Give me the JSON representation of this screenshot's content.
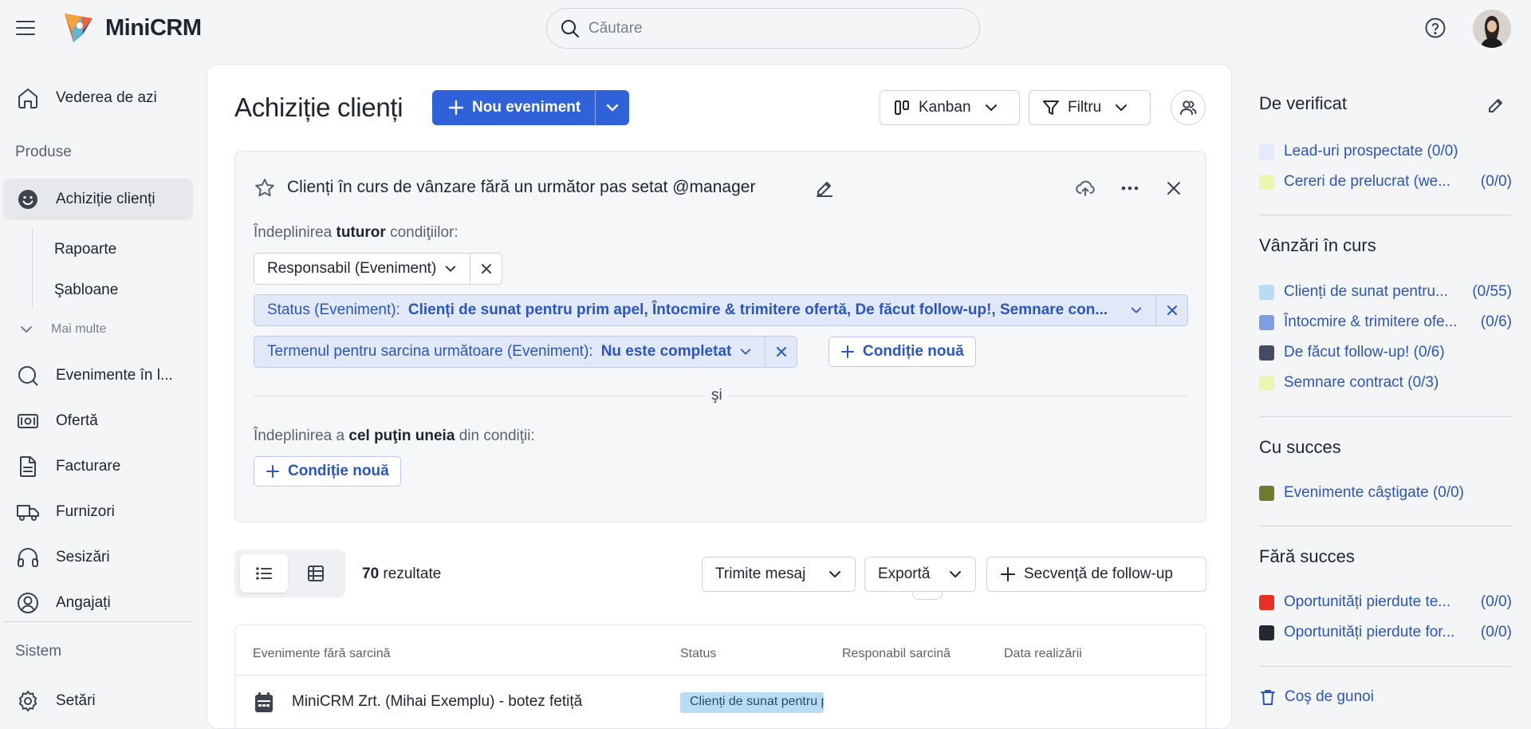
{
  "app": {
    "name": "MiniCRM"
  },
  "search": {
    "placeholder": "Căutare"
  },
  "sidebar": {
    "today": "Vederea de azi",
    "section_products": "Produse",
    "active_item": "Achiziție clienți",
    "sub_items": [
      "Rapoarte",
      "Şabloane"
    ],
    "more": "Mai multe",
    "items": [
      "Evenimente în l...",
      "Ofertă",
      "Facturare",
      "Furnizori",
      "Sesizări",
      "Angajați"
    ],
    "section_system": "Sistem",
    "settings": "Setări"
  },
  "main": {
    "title": "Achiziție clienți",
    "new_event": "Nou eveniment",
    "kanban": "Kanban",
    "filter": "Filtru"
  },
  "filter_box": {
    "title": "Clienți în curs de vânzare fără un următor pas setat @manager",
    "all_conditions": {
      "pre": "Îndeplinirea",
      "bold": "tuturor",
      "post": "condiţiilor:"
    },
    "chip_responsible": "Responsabil (Eveniment)",
    "chip_status": {
      "label": "Status (Eveniment):",
      "value": "Clienți de sunat pentru prim apel, Întocmire & trimitere ofertă, De făcut follow-up!, Semnare con..."
    },
    "chip_deadline": {
      "label": "Termenul pentru sarcina următoare (Eveniment):",
      "value": "Nu este completat"
    },
    "new_condition": "Condiție nouă",
    "and_text": "şi",
    "any_condition": {
      "pre": "Îndeplinirea a",
      "bold": "cel puţin uneia",
      "post": "din condiţii:"
    },
    "new_condition_2": "Condiție nouă"
  },
  "results": {
    "count": "70",
    "label": "rezultate"
  },
  "actions": {
    "send_message": "Trimite mesaj",
    "export": "Exportă",
    "followup": "Secvenţă de follow-up"
  },
  "table": {
    "headers": [
      "Evenimente fără sarcină",
      "Status",
      "Responabil sarcină",
      "Data realizării"
    ],
    "rows": [
      {
        "name": "MiniCRM Zrt. (Mihai Exemplu) - botez fetiță",
        "status": "Clienți de sunat pentru prim apel"
      }
    ]
  },
  "right_panel": {
    "sections": [
      {
        "title": "De verificat",
        "items": [
          {
            "label": "Lead-uri prospectate (0/0)",
            "count": "",
            "color": "#e3ebfa"
          },
          {
            "label": "Cereri de prelucrat (we...",
            "count": "(0/0)",
            "color": "#eef5b0"
          }
        ]
      },
      {
        "title": "Vânzări în curs",
        "items": [
          {
            "label": "Clienți de sunat pentru...",
            "count": "(0/55)",
            "color": "#b8dcf2"
          },
          {
            "label": "Întocmire & trimitere ofe...",
            "count": "(0/6)",
            "color": "#7f9ee0"
          },
          {
            "label": "De făcut follow-up! (0/6)",
            "count": "",
            "color": "#434b66"
          },
          {
            "label": "Semnare contract (0/3)",
            "count": "",
            "color": "#eef5b0"
          }
        ]
      },
      {
        "title": "Cu succes",
        "items": [
          {
            "label": "Evenimente câştigate (0/0)",
            "count": "",
            "color": "#6c7d2f"
          }
        ]
      },
      {
        "title": "Fără succes",
        "items": [
          {
            "label": "Oportunități pierdute te...",
            "count": "(0/0)",
            "color": "#e53023"
          },
          {
            "label": "Oportunități pierdute for...",
            "count": "(0/0)",
            "color": "#232833"
          }
        ]
      }
    ],
    "trash": "Coş de gunoi"
  }
}
